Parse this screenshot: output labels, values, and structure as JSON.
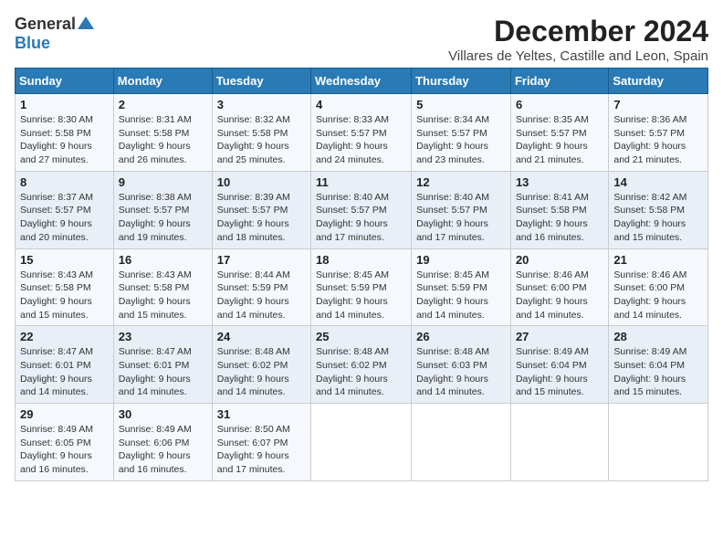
{
  "header": {
    "logo_general": "General",
    "logo_blue": "Blue",
    "title": "December 2024",
    "subtitle": "Villares de Yeltes, Castille and Leon, Spain"
  },
  "calendar": {
    "columns": [
      "Sunday",
      "Monday",
      "Tuesday",
      "Wednesday",
      "Thursday",
      "Friday",
      "Saturday"
    ],
    "weeks": [
      [
        {
          "day": "1",
          "sunrise": "8:30 AM",
          "sunset": "5:58 PM",
          "daylight": "9 hours and 27 minutes."
        },
        {
          "day": "2",
          "sunrise": "8:31 AM",
          "sunset": "5:58 PM",
          "daylight": "9 hours and 26 minutes."
        },
        {
          "day": "3",
          "sunrise": "8:32 AM",
          "sunset": "5:58 PM",
          "daylight": "9 hours and 25 minutes."
        },
        {
          "day": "4",
          "sunrise": "8:33 AM",
          "sunset": "5:57 PM",
          "daylight": "9 hours and 24 minutes."
        },
        {
          "day": "5",
          "sunrise": "8:34 AM",
          "sunset": "5:57 PM",
          "daylight": "9 hours and 23 minutes."
        },
        {
          "day": "6",
          "sunrise": "8:35 AM",
          "sunset": "5:57 PM",
          "daylight": "9 hours and 21 minutes."
        },
        {
          "day": "7",
          "sunrise": "8:36 AM",
          "sunset": "5:57 PM",
          "daylight": "9 hours and 21 minutes."
        }
      ],
      [
        {
          "day": "8",
          "sunrise": "8:37 AM",
          "sunset": "5:57 PM",
          "daylight": "9 hours and 20 minutes."
        },
        {
          "day": "9",
          "sunrise": "8:38 AM",
          "sunset": "5:57 PM",
          "daylight": "9 hours and 19 minutes."
        },
        {
          "day": "10",
          "sunrise": "8:39 AM",
          "sunset": "5:57 PM",
          "daylight": "9 hours and 18 minutes."
        },
        {
          "day": "11",
          "sunrise": "8:40 AM",
          "sunset": "5:57 PM",
          "daylight": "9 hours and 17 minutes."
        },
        {
          "day": "12",
          "sunrise": "8:40 AM",
          "sunset": "5:57 PM",
          "daylight": "9 hours and 17 minutes."
        },
        {
          "day": "13",
          "sunrise": "8:41 AM",
          "sunset": "5:58 PM",
          "daylight": "9 hours and 16 minutes."
        },
        {
          "day": "14",
          "sunrise": "8:42 AM",
          "sunset": "5:58 PM",
          "daylight": "9 hours and 15 minutes."
        }
      ],
      [
        {
          "day": "15",
          "sunrise": "8:43 AM",
          "sunset": "5:58 PM",
          "daylight": "9 hours and 15 minutes."
        },
        {
          "day": "16",
          "sunrise": "8:43 AM",
          "sunset": "5:58 PM",
          "daylight": "9 hours and 15 minutes."
        },
        {
          "day": "17",
          "sunrise": "8:44 AM",
          "sunset": "5:59 PM",
          "daylight": "9 hours and 14 minutes."
        },
        {
          "day": "18",
          "sunrise": "8:45 AM",
          "sunset": "5:59 PM",
          "daylight": "9 hours and 14 minutes."
        },
        {
          "day": "19",
          "sunrise": "8:45 AM",
          "sunset": "5:59 PM",
          "daylight": "9 hours and 14 minutes."
        },
        {
          "day": "20",
          "sunrise": "8:46 AM",
          "sunset": "6:00 PM",
          "daylight": "9 hours and 14 minutes."
        },
        {
          "day": "21",
          "sunrise": "8:46 AM",
          "sunset": "6:00 PM",
          "daylight": "9 hours and 14 minutes."
        }
      ],
      [
        {
          "day": "22",
          "sunrise": "8:47 AM",
          "sunset": "6:01 PM",
          "daylight": "9 hours and 14 minutes."
        },
        {
          "day": "23",
          "sunrise": "8:47 AM",
          "sunset": "6:01 PM",
          "daylight": "9 hours and 14 minutes."
        },
        {
          "day": "24",
          "sunrise": "8:48 AM",
          "sunset": "6:02 PM",
          "daylight": "9 hours and 14 minutes."
        },
        {
          "day": "25",
          "sunrise": "8:48 AM",
          "sunset": "6:02 PM",
          "daylight": "9 hours and 14 minutes."
        },
        {
          "day": "26",
          "sunrise": "8:48 AM",
          "sunset": "6:03 PM",
          "daylight": "9 hours and 14 minutes."
        },
        {
          "day": "27",
          "sunrise": "8:49 AM",
          "sunset": "6:04 PM",
          "daylight": "9 hours and 15 minutes."
        },
        {
          "day": "28",
          "sunrise": "8:49 AM",
          "sunset": "6:04 PM",
          "daylight": "9 hours and 15 minutes."
        }
      ],
      [
        {
          "day": "29",
          "sunrise": "8:49 AM",
          "sunset": "6:05 PM",
          "daylight": "9 hours and 16 minutes."
        },
        {
          "day": "30",
          "sunrise": "8:49 AM",
          "sunset": "6:06 PM",
          "daylight": "9 hours and 16 minutes."
        },
        {
          "day": "31",
          "sunrise": "8:50 AM",
          "sunset": "6:07 PM",
          "daylight": "9 hours and 17 minutes."
        },
        null,
        null,
        null,
        null
      ]
    ]
  },
  "labels": {
    "sunrise": "Sunrise:",
    "sunset": "Sunset:",
    "daylight": "Daylight:"
  }
}
